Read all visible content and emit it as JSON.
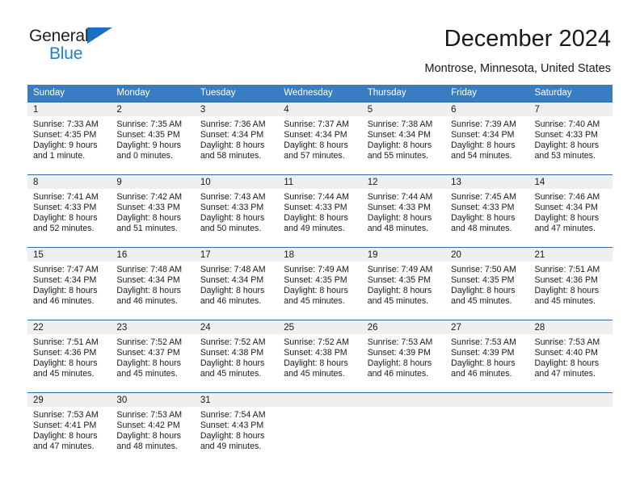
{
  "brand": {
    "name_part1": "General",
    "name_part2": "Blue",
    "triangle_icon": "triangle-icon",
    "colors": {
      "dark": "#231f20",
      "blue": "#1b7fd4",
      "accent": "#3a7cc0"
    }
  },
  "header": {
    "title": "December 2024",
    "subtitle": "Montrose, Minnesota, United States"
  },
  "weekday_headers": [
    "Sunday",
    "Monday",
    "Tuesday",
    "Wednesday",
    "Thursday",
    "Friday",
    "Saturday"
  ],
  "weeks": [
    [
      {
        "day": "1",
        "sunrise": "Sunrise: 7:33 AM",
        "sunset": "Sunset: 4:35 PM",
        "daylight1": "Daylight: 9 hours",
        "daylight2": "and 1 minute."
      },
      {
        "day": "2",
        "sunrise": "Sunrise: 7:35 AM",
        "sunset": "Sunset: 4:35 PM",
        "daylight1": "Daylight: 9 hours",
        "daylight2": "and 0 minutes."
      },
      {
        "day": "3",
        "sunrise": "Sunrise: 7:36 AM",
        "sunset": "Sunset: 4:34 PM",
        "daylight1": "Daylight: 8 hours",
        "daylight2": "and 58 minutes."
      },
      {
        "day": "4",
        "sunrise": "Sunrise: 7:37 AM",
        "sunset": "Sunset: 4:34 PM",
        "daylight1": "Daylight: 8 hours",
        "daylight2": "and 57 minutes."
      },
      {
        "day": "5",
        "sunrise": "Sunrise: 7:38 AM",
        "sunset": "Sunset: 4:34 PM",
        "daylight1": "Daylight: 8 hours",
        "daylight2": "and 55 minutes."
      },
      {
        "day": "6",
        "sunrise": "Sunrise: 7:39 AM",
        "sunset": "Sunset: 4:34 PM",
        "daylight1": "Daylight: 8 hours",
        "daylight2": "and 54 minutes."
      },
      {
        "day": "7",
        "sunrise": "Sunrise: 7:40 AM",
        "sunset": "Sunset: 4:33 PM",
        "daylight1": "Daylight: 8 hours",
        "daylight2": "and 53 minutes."
      }
    ],
    [
      {
        "day": "8",
        "sunrise": "Sunrise: 7:41 AM",
        "sunset": "Sunset: 4:33 PM",
        "daylight1": "Daylight: 8 hours",
        "daylight2": "and 52 minutes."
      },
      {
        "day": "9",
        "sunrise": "Sunrise: 7:42 AM",
        "sunset": "Sunset: 4:33 PM",
        "daylight1": "Daylight: 8 hours",
        "daylight2": "and 51 minutes."
      },
      {
        "day": "10",
        "sunrise": "Sunrise: 7:43 AM",
        "sunset": "Sunset: 4:33 PM",
        "daylight1": "Daylight: 8 hours",
        "daylight2": "and 50 minutes."
      },
      {
        "day": "11",
        "sunrise": "Sunrise: 7:44 AM",
        "sunset": "Sunset: 4:33 PM",
        "daylight1": "Daylight: 8 hours",
        "daylight2": "and 49 minutes."
      },
      {
        "day": "12",
        "sunrise": "Sunrise: 7:44 AM",
        "sunset": "Sunset: 4:33 PM",
        "daylight1": "Daylight: 8 hours",
        "daylight2": "and 48 minutes."
      },
      {
        "day": "13",
        "sunrise": "Sunrise: 7:45 AM",
        "sunset": "Sunset: 4:33 PM",
        "daylight1": "Daylight: 8 hours",
        "daylight2": "and 48 minutes."
      },
      {
        "day": "14",
        "sunrise": "Sunrise: 7:46 AM",
        "sunset": "Sunset: 4:34 PM",
        "daylight1": "Daylight: 8 hours",
        "daylight2": "and 47 minutes."
      }
    ],
    [
      {
        "day": "15",
        "sunrise": "Sunrise: 7:47 AM",
        "sunset": "Sunset: 4:34 PM",
        "daylight1": "Daylight: 8 hours",
        "daylight2": "and 46 minutes."
      },
      {
        "day": "16",
        "sunrise": "Sunrise: 7:48 AM",
        "sunset": "Sunset: 4:34 PM",
        "daylight1": "Daylight: 8 hours",
        "daylight2": "and 46 minutes."
      },
      {
        "day": "17",
        "sunrise": "Sunrise: 7:48 AM",
        "sunset": "Sunset: 4:34 PM",
        "daylight1": "Daylight: 8 hours",
        "daylight2": "and 46 minutes."
      },
      {
        "day": "18",
        "sunrise": "Sunrise: 7:49 AM",
        "sunset": "Sunset: 4:35 PM",
        "daylight1": "Daylight: 8 hours",
        "daylight2": "and 45 minutes."
      },
      {
        "day": "19",
        "sunrise": "Sunrise: 7:49 AM",
        "sunset": "Sunset: 4:35 PM",
        "daylight1": "Daylight: 8 hours",
        "daylight2": "and 45 minutes."
      },
      {
        "day": "20",
        "sunrise": "Sunrise: 7:50 AM",
        "sunset": "Sunset: 4:35 PM",
        "daylight1": "Daylight: 8 hours",
        "daylight2": "and 45 minutes."
      },
      {
        "day": "21",
        "sunrise": "Sunrise: 7:51 AM",
        "sunset": "Sunset: 4:36 PM",
        "daylight1": "Daylight: 8 hours",
        "daylight2": "and 45 minutes."
      }
    ],
    [
      {
        "day": "22",
        "sunrise": "Sunrise: 7:51 AM",
        "sunset": "Sunset: 4:36 PM",
        "daylight1": "Daylight: 8 hours",
        "daylight2": "and 45 minutes."
      },
      {
        "day": "23",
        "sunrise": "Sunrise: 7:52 AM",
        "sunset": "Sunset: 4:37 PM",
        "daylight1": "Daylight: 8 hours",
        "daylight2": "and 45 minutes."
      },
      {
        "day": "24",
        "sunrise": "Sunrise: 7:52 AM",
        "sunset": "Sunset: 4:38 PM",
        "daylight1": "Daylight: 8 hours",
        "daylight2": "and 45 minutes."
      },
      {
        "day": "25",
        "sunrise": "Sunrise: 7:52 AM",
        "sunset": "Sunset: 4:38 PM",
        "daylight1": "Daylight: 8 hours",
        "daylight2": "and 45 minutes."
      },
      {
        "day": "26",
        "sunrise": "Sunrise: 7:53 AM",
        "sunset": "Sunset: 4:39 PM",
        "daylight1": "Daylight: 8 hours",
        "daylight2": "and 46 minutes."
      },
      {
        "day": "27",
        "sunrise": "Sunrise: 7:53 AM",
        "sunset": "Sunset: 4:39 PM",
        "daylight1": "Daylight: 8 hours",
        "daylight2": "and 46 minutes."
      },
      {
        "day": "28",
        "sunrise": "Sunrise: 7:53 AM",
        "sunset": "Sunset: 4:40 PM",
        "daylight1": "Daylight: 8 hours",
        "daylight2": "and 47 minutes."
      }
    ],
    [
      {
        "day": "29",
        "sunrise": "Sunrise: 7:53 AM",
        "sunset": "Sunset: 4:41 PM",
        "daylight1": "Daylight: 8 hours",
        "daylight2": "and 47 minutes."
      },
      {
        "day": "30",
        "sunrise": "Sunrise: 7:53 AM",
        "sunset": "Sunset: 4:42 PM",
        "daylight1": "Daylight: 8 hours",
        "daylight2": "and 48 minutes."
      },
      {
        "day": "31",
        "sunrise": "Sunrise: 7:54 AM",
        "sunset": "Sunset: 4:43 PM",
        "daylight1": "Daylight: 8 hours",
        "daylight2": "and 49 minutes."
      },
      {
        "day": "",
        "sunrise": "",
        "sunset": "",
        "daylight1": "",
        "daylight2": ""
      },
      {
        "day": "",
        "sunrise": "",
        "sunset": "",
        "daylight1": "",
        "daylight2": ""
      },
      {
        "day": "",
        "sunrise": "",
        "sunset": "",
        "daylight1": "",
        "daylight2": ""
      },
      {
        "day": "",
        "sunrise": "",
        "sunset": "",
        "daylight1": "",
        "daylight2": ""
      }
    ]
  ]
}
